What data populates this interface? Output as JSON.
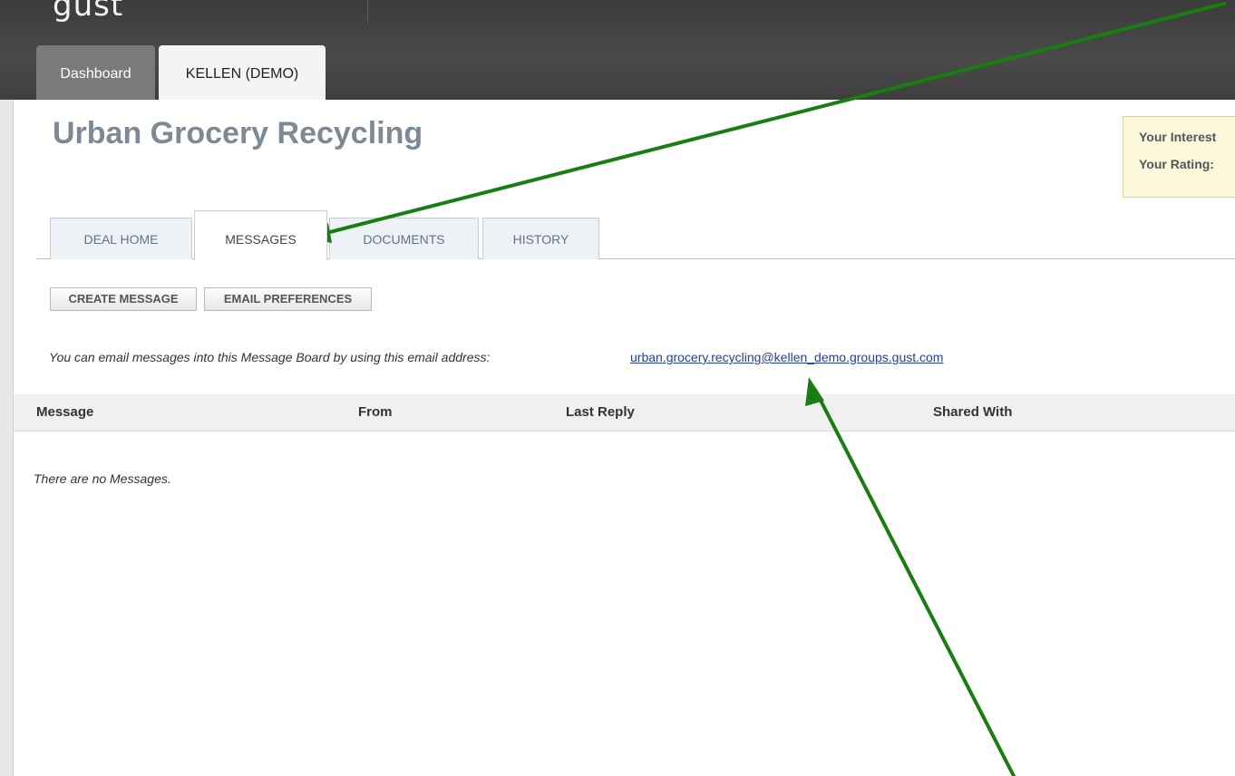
{
  "brand": {
    "logo_text": "gust"
  },
  "top_tabs": [
    {
      "label": "Dashboard"
    },
    {
      "label": "KELLEN (DEMO)"
    }
  ],
  "page": {
    "title": "Urban Grocery Recycling"
  },
  "interest_box": {
    "interest_label": "Your Interest",
    "rating_label": "Your Rating:"
  },
  "deal_tabs": [
    {
      "label": "DEAL HOME",
      "active": false
    },
    {
      "label": "MESSAGES",
      "active": true
    },
    {
      "label": "DOCUMENTS",
      "active": false
    },
    {
      "label": "HISTORY",
      "active": false
    }
  ],
  "actions": {
    "create_message": "CREATE MESSAGE",
    "email_preferences": "EMAIL PREFERENCES"
  },
  "email_info": {
    "note": "You can email messages into this Message Board by using this email address:",
    "address": "urban.grocery.recycling@kellen_demo.groups.gust.com"
  },
  "messages_table": {
    "columns": [
      "Message",
      "From",
      "Last Reply",
      "Shared With"
    ],
    "rows": [],
    "empty_text": "There are no Messages."
  },
  "colors": {
    "annotation_arrow": "#1a7d12",
    "title": "#7d8a96",
    "link": "#22409a",
    "header_bg": "#3e3e3e"
  }
}
